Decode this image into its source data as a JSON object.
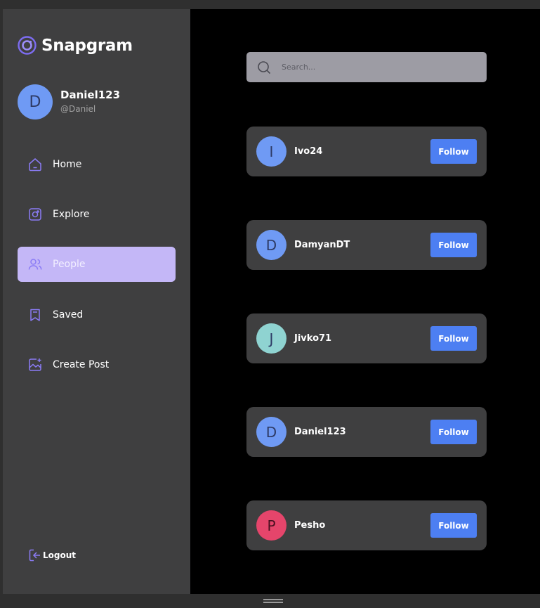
{
  "app": {
    "name": "Snapgram",
    "accent": "#8b7cf6"
  },
  "profile": {
    "initial": "D",
    "name": "Daniel123",
    "handle": "@Daniel",
    "avatar_color": "#6f9af4"
  },
  "nav": [
    {
      "label": "Home",
      "icon": "home-icon",
      "active": false
    },
    {
      "label": "Explore",
      "icon": "explore-icon",
      "active": false
    },
    {
      "label": "People",
      "icon": "people-icon",
      "active": true
    },
    {
      "label": "Saved",
      "icon": "bookmark-icon",
      "active": false
    },
    {
      "label": "Create Post",
      "icon": "image-add-icon",
      "active": false
    }
  ],
  "logout": {
    "label": "Logout",
    "icon": "logout-icon"
  },
  "search": {
    "placeholder": "Search...",
    "value": ""
  },
  "people": [
    {
      "initial": "I",
      "name": "Ivo24",
      "avatar_color": "#6f9af4",
      "button": "Follow"
    },
    {
      "initial": "D",
      "name": "DamyanDT",
      "avatar_color": "#6f9af4",
      "button": "Follow"
    },
    {
      "initial": "J",
      "name": "Jivko71",
      "avatar_color": "#8fd3d1",
      "button": "Follow"
    },
    {
      "initial": "D",
      "name": "Daniel123",
      "avatar_color": "#6f9af4",
      "button": "Follow"
    },
    {
      "initial": "P",
      "name": "Pesho",
      "avatar_color": "#e5456b",
      "button": "Follow"
    }
  ]
}
